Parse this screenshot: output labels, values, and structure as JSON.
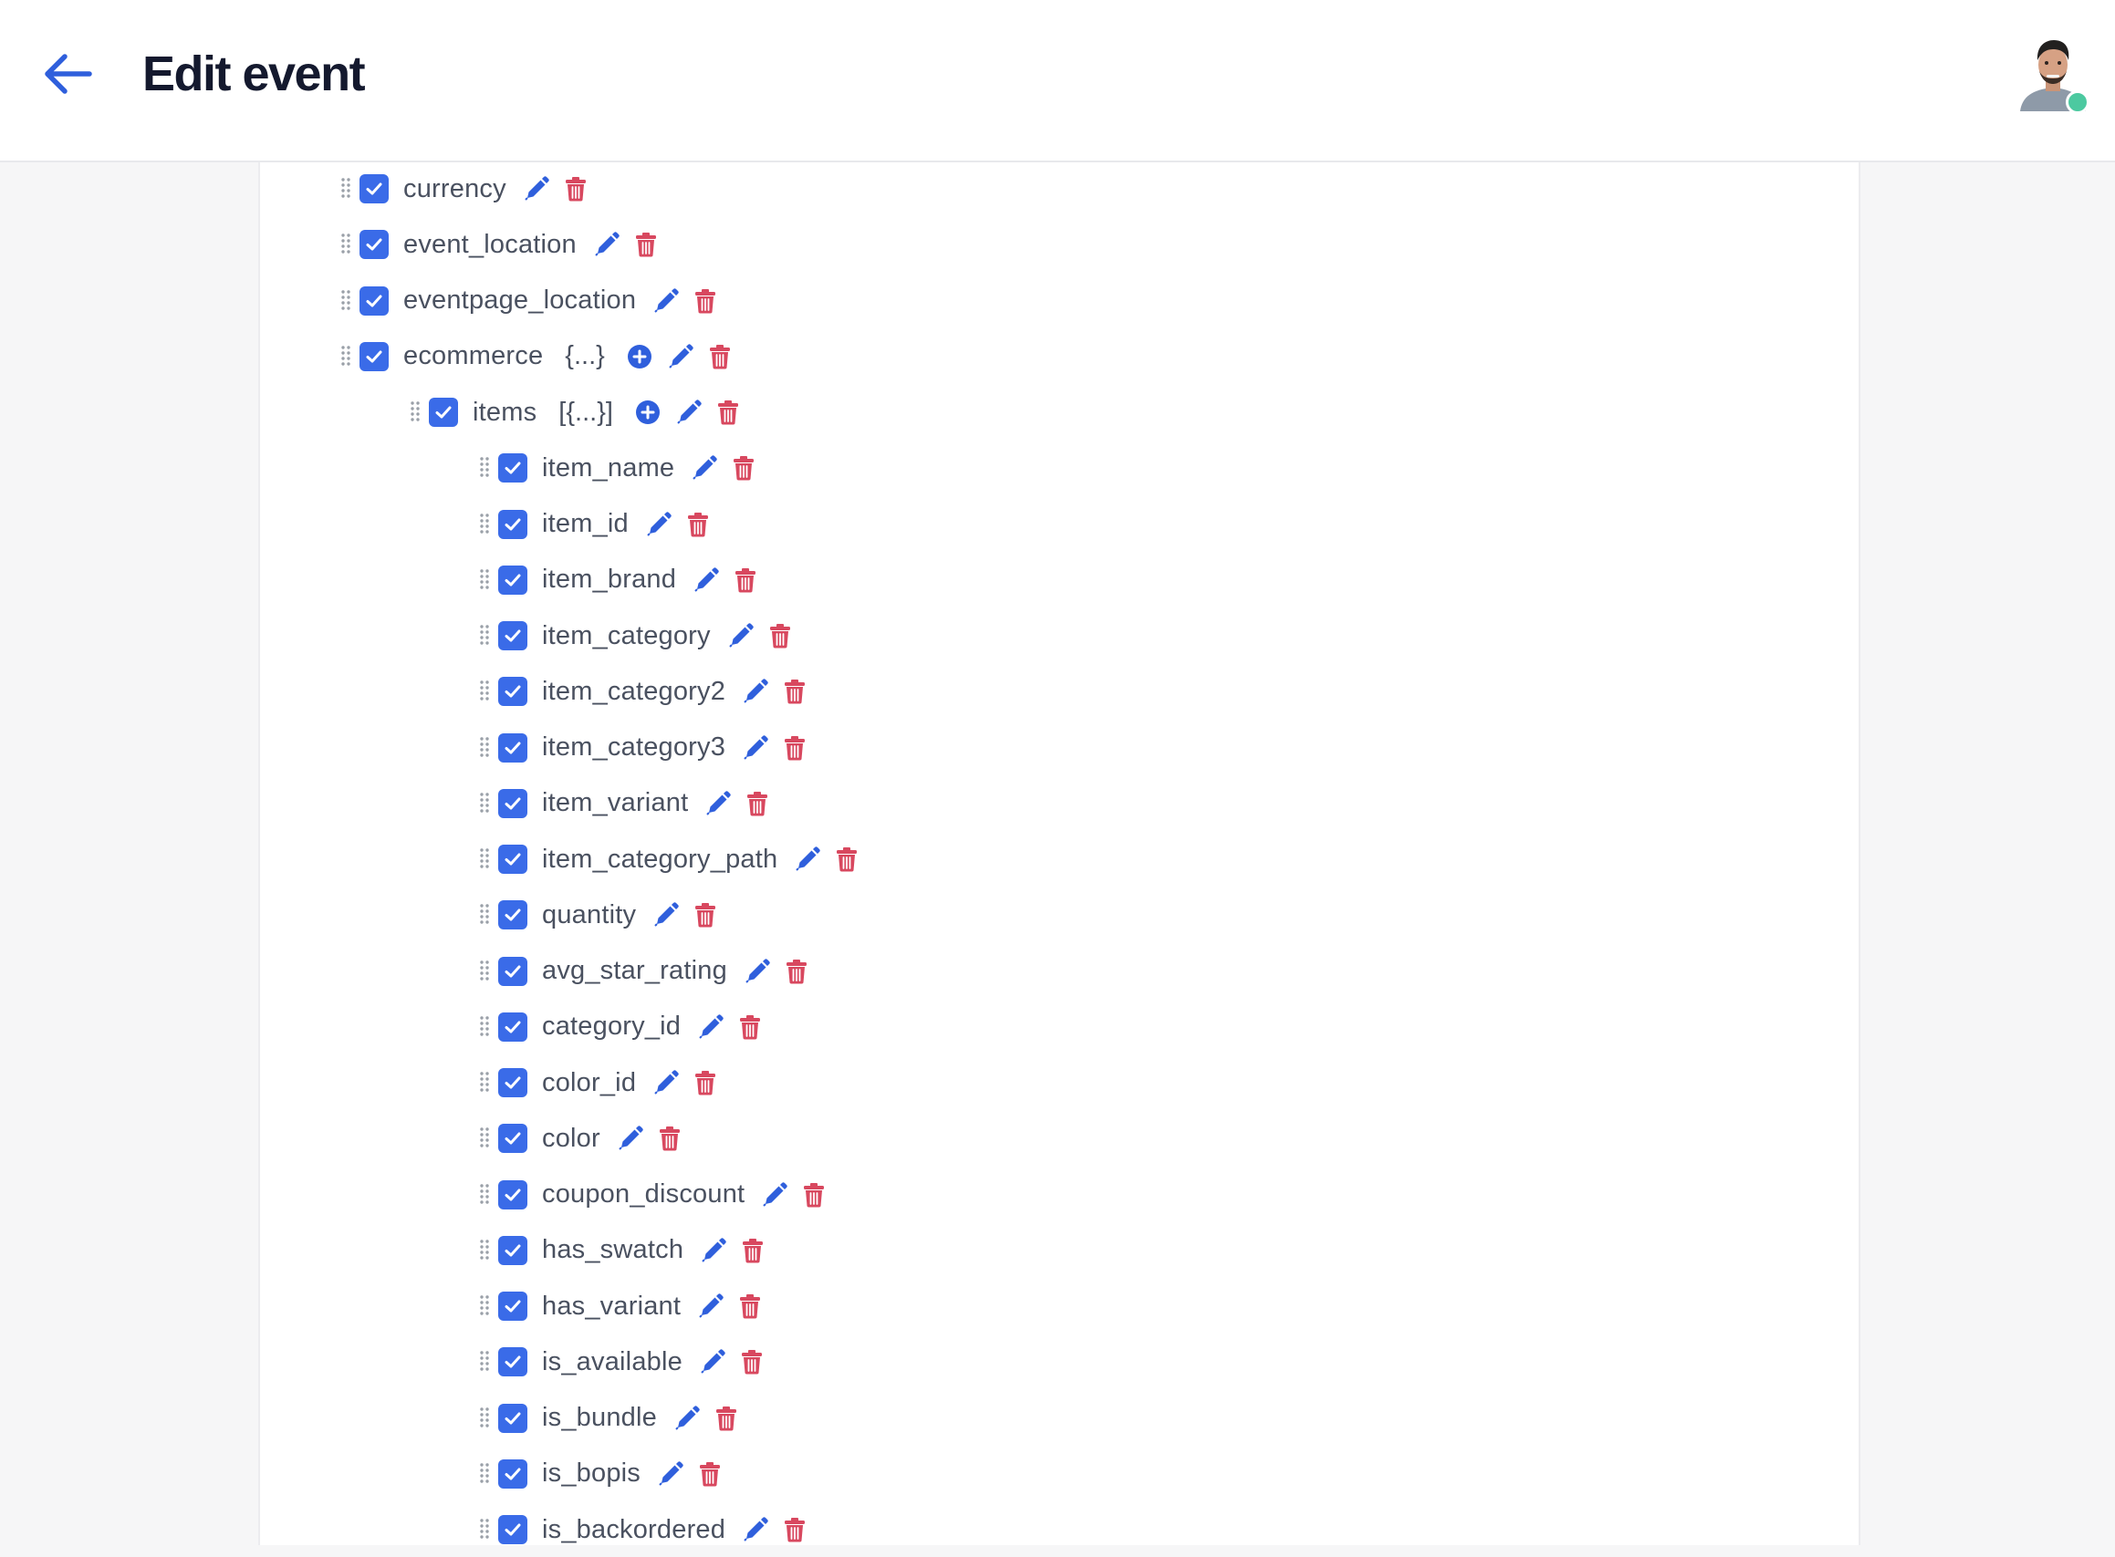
{
  "header": {
    "title": "Edit event"
  },
  "colors": {
    "accent": "#3a6be8",
    "icon_blue": "#2f5fdc",
    "delete_red": "#d8485f",
    "online": "#4cc9a0"
  },
  "icons": {
    "back": "arrow-left-icon",
    "drag": "drag-handle-icon",
    "checkbox": "checkbox-checked-icon",
    "add": "plus-circle-icon",
    "edit": "pencil-icon",
    "delete": "trash-icon"
  },
  "tree": [
    {
      "label": "currency",
      "depth": 0,
      "checked": true
    },
    {
      "label": "event_location",
      "depth": 0,
      "checked": true
    },
    {
      "label": "eventpage_location",
      "depth": 0,
      "checked": true
    },
    {
      "label": "ecommerce",
      "depth": 0,
      "checked": true,
      "type": "{...}",
      "addable": true
    },
    {
      "label": "items",
      "depth": 1,
      "checked": true,
      "type": "[{...}]",
      "addable": true
    },
    {
      "label": "item_name",
      "depth": 2,
      "checked": true
    },
    {
      "label": "item_id",
      "depth": 2,
      "checked": true
    },
    {
      "label": "item_brand",
      "depth": 2,
      "checked": true
    },
    {
      "label": "item_category",
      "depth": 2,
      "checked": true
    },
    {
      "label": "item_category2",
      "depth": 2,
      "checked": true
    },
    {
      "label": "item_category3",
      "depth": 2,
      "checked": true
    },
    {
      "label": "item_variant",
      "depth": 2,
      "checked": true
    },
    {
      "label": "item_category_path",
      "depth": 2,
      "checked": true
    },
    {
      "label": "quantity",
      "depth": 2,
      "checked": true
    },
    {
      "label": "avg_star_rating",
      "depth": 2,
      "checked": true
    },
    {
      "label": "category_id",
      "depth": 2,
      "checked": true
    },
    {
      "label": "color_id",
      "depth": 2,
      "checked": true
    },
    {
      "label": "color",
      "depth": 2,
      "checked": true
    },
    {
      "label": "coupon_discount",
      "depth": 2,
      "checked": true
    },
    {
      "label": "has_swatch",
      "depth": 2,
      "checked": true
    },
    {
      "label": "has_variant",
      "depth": 2,
      "checked": true
    },
    {
      "label": "is_available",
      "depth": 2,
      "checked": true
    },
    {
      "label": "is_bundle",
      "depth": 2,
      "checked": true
    },
    {
      "label": "is_bopis",
      "depth": 2,
      "checked": true
    },
    {
      "label": "is_backordered",
      "depth": 2,
      "checked": true
    }
  ]
}
